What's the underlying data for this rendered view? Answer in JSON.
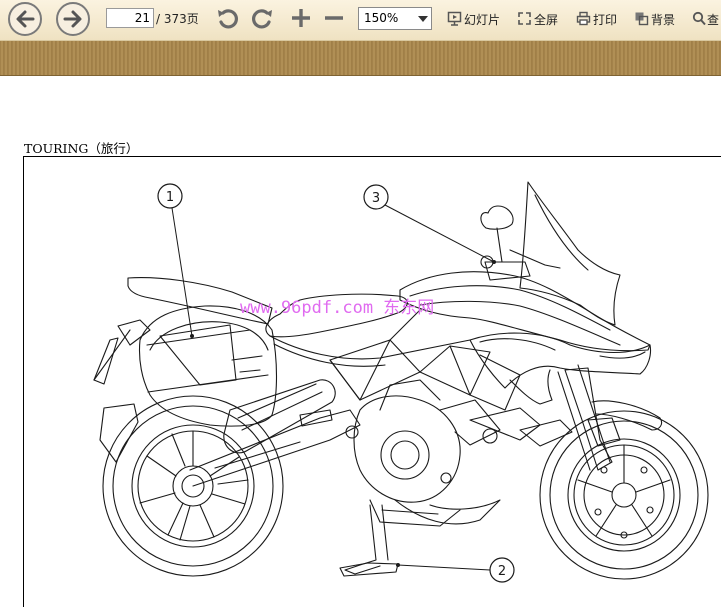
{
  "toolbar": {
    "page_current": "21",
    "page_total": "/ 373页",
    "zoom": "150%",
    "slideshow_label": "幻灯片",
    "fullscreen_label": "全屏",
    "print_label": "打印",
    "background_label": "背景",
    "search_label": "查"
  },
  "document": {
    "section_title": "TOURING（旅行）",
    "callouts": [
      "1",
      "2",
      "3"
    ],
    "watermark": "www.96pdf.com 东东网"
  },
  "colors": {
    "toolbar_bg": "#f4e9d0",
    "band": "#a8874f",
    "watermark": "#e06bf0"
  }
}
